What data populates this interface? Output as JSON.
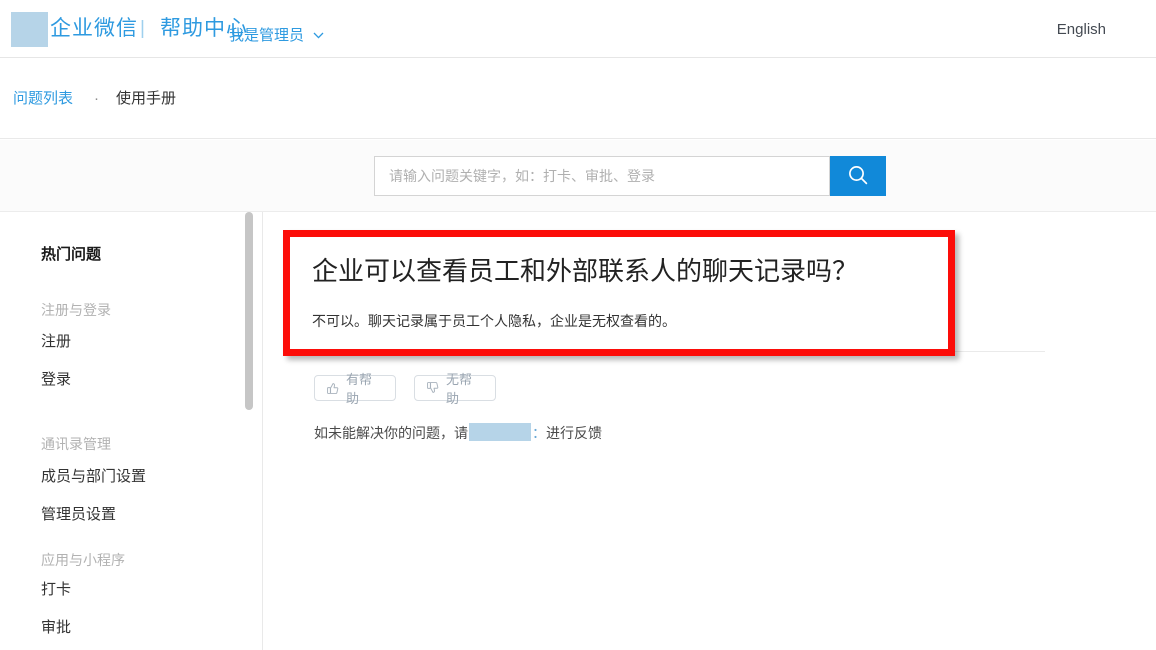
{
  "header": {
    "logo_icon": "redacted-logo-block",
    "brand": "企业微信",
    "separator": "|",
    "help_center": "帮助中心",
    "language_link": "English"
  },
  "nav": {
    "items": [
      {
        "label": "问题列表",
        "active": true
      },
      {
        "label": "使用手册",
        "active": false
      }
    ],
    "dot": "·"
  },
  "search": {
    "role_label": "我是管理员",
    "role_caret_icon": "chevron-down-icon",
    "placeholder": "请输入问题关键字，如：打卡、审批、登录",
    "value": "",
    "button_icon": "search-icon",
    "accent_color": "#1189d9"
  },
  "sidebar": {
    "hot_label": "热门问题",
    "groups": [
      {
        "title": "注册与登录",
        "items": [
          "注册",
          "登录"
        ]
      },
      {
        "title": "通讯录管理",
        "items": [
          "成员与部门设置",
          "管理员设置"
        ]
      },
      {
        "title": "应用与小程序",
        "items": [
          "打卡",
          "审批"
        ]
      }
    ],
    "scrollbar": {
      "thumb_color": "#c6c6c6"
    }
  },
  "content": {
    "question_title": "企业可以查看员工和外部联系人的聊天记录吗？",
    "answer_text": "不可以。聊天记录属于员工个人隐私，企业是无权查看的。",
    "feedback": {
      "helpful_label": "有帮助",
      "helpful_icon": "thumbs-up-icon",
      "unhelpful_label": "无帮助",
      "unhelpful_icon": "thumbs-down-icon"
    },
    "feedback_note": {
      "prefix": "如未能解决你的问题，请",
      "redacted": "",
      "colon": "：",
      "suffix": "进行反馈"
    }
  },
  "annotation": {
    "color": "#fc0d09",
    "shape": "rectangle-highlight"
  }
}
